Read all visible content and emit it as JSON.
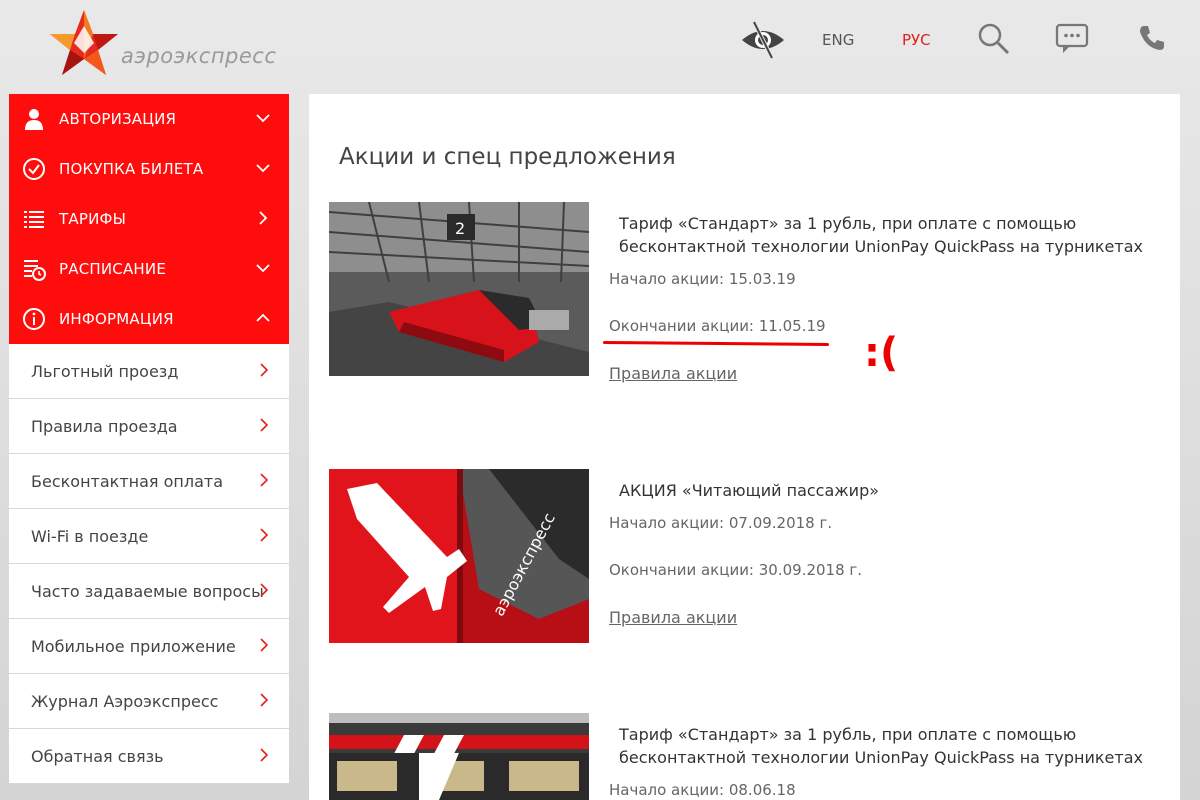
{
  "header": {
    "logo_text": "аэроэкспресс",
    "lang_eng": "ENG",
    "lang_rus": "РУС",
    "icons": [
      "accessibility-eye-icon",
      "search-icon",
      "chat-icon",
      "phone-icon"
    ]
  },
  "sidebar": {
    "main_items": [
      {
        "label": "АВТОРИЗАЦИЯ",
        "icon": "user-icon",
        "chevron": "down"
      },
      {
        "label": "ПОКУПКА БИЛЕТА",
        "icon": "check-circle-icon",
        "chevron": "down"
      },
      {
        "label": "ТАРИФЫ",
        "icon": "list-icon",
        "chevron": "right"
      },
      {
        "label": "РАСПИСАНИЕ",
        "icon": "schedule-icon",
        "chevron": "down"
      },
      {
        "label": "ИНФОРМАЦИЯ",
        "icon": "info-icon",
        "chevron": "up"
      }
    ],
    "sub_items": [
      "Льготный проезд",
      "Правила проезда",
      "Бесконтактная оплата",
      "Wi-Fi в поезде",
      "Часто задаваемые вопросы",
      "Мобильное приложение",
      "Журнал Аэроэкспресс",
      "Обратная связь"
    ]
  },
  "content": {
    "title": "Акции и спец предложения",
    "promos": [
      {
        "title": "Тариф «Стандарт» за 1 рубль, при оплате с помощью бесконтактной технологии UnionPay QuickPass на турникетах",
        "start": "Начало акции: 15.03.19",
        "end": "Окончании акции: 11.05.19",
        "rules": "Правила акции",
        "platform_number": "2"
      },
      {
        "title": "АКЦИЯ «Читающий пассажир»",
        "start": "Начало акции: 07.09.2018 г.",
        "end": "Окончании акции: 30.09.2018 г.",
        "rules": "Правила акции",
        "train_text": "аэроэкспресс"
      },
      {
        "title": "Тариф «Стандарт» за 1 рубль, при оплате с помощью бесконтактной технологии UnionPay QuickPass на турникетах",
        "start": "Начало акции: 08.06.18"
      }
    ]
  },
  "annotation": {
    "face": ":(",
    "color": "#e00000"
  },
  "colors": {
    "brand_red": "#ff0c0c",
    "text_dark": "#333333"
  }
}
